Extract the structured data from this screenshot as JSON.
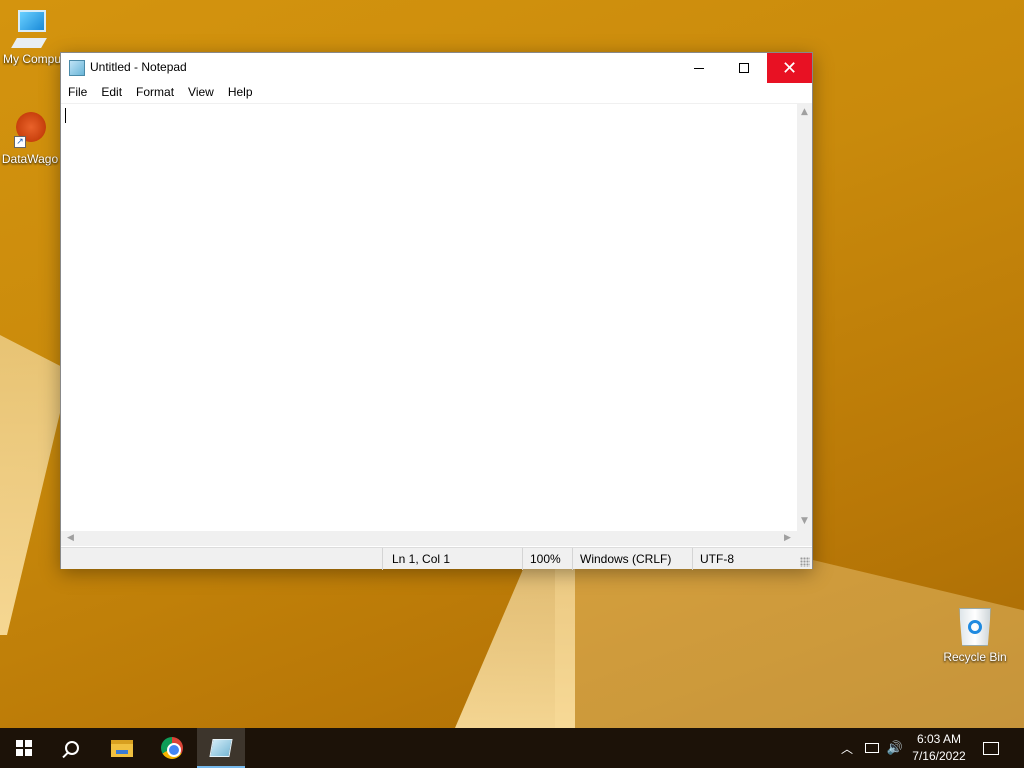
{
  "desktop": {
    "icons": [
      {
        "label": "My Compu"
      },
      {
        "label": "DataWago"
      },
      {
        "label": "Recycle Bin"
      }
    ]
  },
  "notepad": {
    "title": "Untitled - Notepad",
    "controls": {
      "minimize": "minimize",
      "maximize": "maximize",
      "close": "✕"
    },
    "menu": [
      "File",
      "Edit",
      "View",
      "Format",
      "Help"
    ],
    "menu_ordered": [
      "File",
      "Edit",
      "Format",
      "View",
      "Help"
    ],
    "content": "",
    "status": {
      "position": "Ln 1, Col 1",
      "zoom": "100%",
      "line_ending": "Windows (CRLF)",
      "encoding": "UTF-8"
    }
  },
  "taskbar": {
    "apps": [
      "start-icon",
      "search-icon",
      "file-explorer-icon",
      "chrome-icon",
      "notepad-icon"
    ],
    "tray": {
      "chevron": "︿",
      "volume": "🔊"
    },
    "clock": {
      "time": "6:03 AM",
      "date": "7/16/2022"
    }
  },
  "colors": {
    "close_button": "#e81123",
    "taskbar": "#1c1208",
    "wallpaper": "#c9860d"
  }
}
